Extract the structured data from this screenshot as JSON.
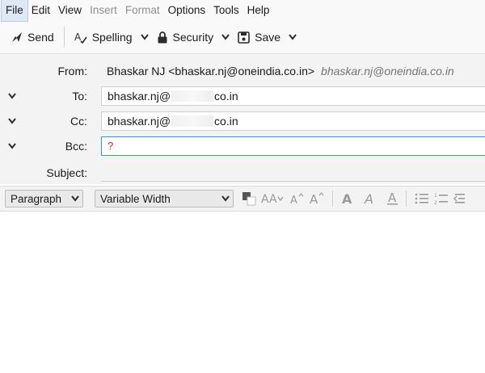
{
  "menubar": {
    "file": "File",
    "edit": "Edit",
    "view": "View",
    "insert": "Insert",
    "format": "Format",
    "options": "Options",
    "tools": "Tools",
    "help": "Help"
  },
  "toolbar": {
    "send": "Send",
    "spelling": "Spelling",
    "security": "Security",
    "save": "Save"
  },
  "header": {
    "from_label": "From:",
    "from_value": "Bhaskar NJ <bhaskar.nj@oneindia.co.in>",
    "from_identity": "bhaskar.nj@oneindia.co.in",
    "to_label": "To:",
    "to_prefix": "bhaskar.nj@",
    "to_suffix": "co.in",
    "cc_label": "Cc:",
    "cc_prefix": "bhaskar.nj@",
    "cc_suffix": "co.in",
    "bcc_label": "Bcc:",
    "bcc_value": "?",
    "subject_label": "Subject:"
  },
  "format_bar": {
    "paragraph": "Paragraph",
    "font": "Variable Width"
  },
  "colors": {
    "focus_border": "#3d8fe0",
    "caret": "#d9261c"
  }
}
